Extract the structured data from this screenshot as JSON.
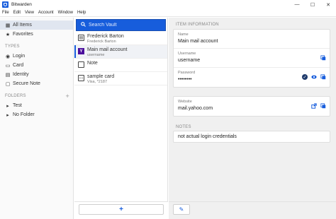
{
  "window": {
    "title": "Bitwarden",
    "controls": {
      "minimize": "—",
      "maximize": "☐",
      "close": "✕"
    }
  },
  "menu": [
    "File",
    "Edit",
    "View",
    "Account",
    "Window",
    "Help"
  ],
  "sidebar": {
    "top_items": [
      {
        "label": "All Items",
        "icon": "grid-icon",
        "glyph": "▦",
        "active": true
      },
      {
        "label": "Favorites",
        "icon": "star-icon",
        "glyph": "★",
        "active": false
      }
    ],
    "types_header": "TYPES",
    "types": [
      {
        "label": "Login",
        "icon": "globe-icon",
        "glyph": "◉"
      },
      {
        "label": "Card",
        "icon": "credit-card-icon",
        "glyph": "▭"
      },
      {
        "label": "Identity",
        "icon": "id-card-icon",
        "glyph": "▤"
      },
      {
        "label": "Secure Note",
        "icon": "note-icon",
        "glyph": "▢"
      }
    ],
    "folders_header": "FOLDERS",
    "folders_add": "+",
    "folders": [
      {
        "label": "Test",
        "glyph": "▸"
      },
      {
        "label": "No Folder",
        "glyph": "▸"
      }
    ]
  },
  "list": {
    "search_placeholder": "Search Vault",
    "items": [
      {
        "name": "Frederick Barton",
        "sub": "Frederick Barton",
        "icon": "id-card-icon",
        "glyph": "▤",
        "selected": false
      },
      {
        "name": "Main mail account",
        "sub": "username",
        "icon": "yahoo-icon",
        "glyph": "Y",
        "selected": true
      },
      {
        "name": "Note",
        "sub": "",
        "icon": "note-icon",
        "glyph": "",
        "selected": false
      },
      {
        "name": "sample card",
        "sub": "Visa, *2187",
        "icon": "credit-card-icon",
        "glyph": "▭",
        "selected": false
      }
    ],
    "add_label": "+"
  },
  "details": {
    "item_info_title": "ITEM INFORMATION",
    "name_label": "Name",
    "name_value": "Main mail account",
    "username_label": "Username",
    "username_value": "username",
    "password_label": "Password",
    "password_value": "••••••••",
    "website_label": "Website",
    "website_value": "mail.yahoo.com",
    "notes_title": "NOTES",
    "notes_value": "not actual login credentials",
    "edit_label": "✎"
  },
  "colors": {
    "accent": "#175ddc",
    "yahoo": "#4b0e9c"
  }
}
